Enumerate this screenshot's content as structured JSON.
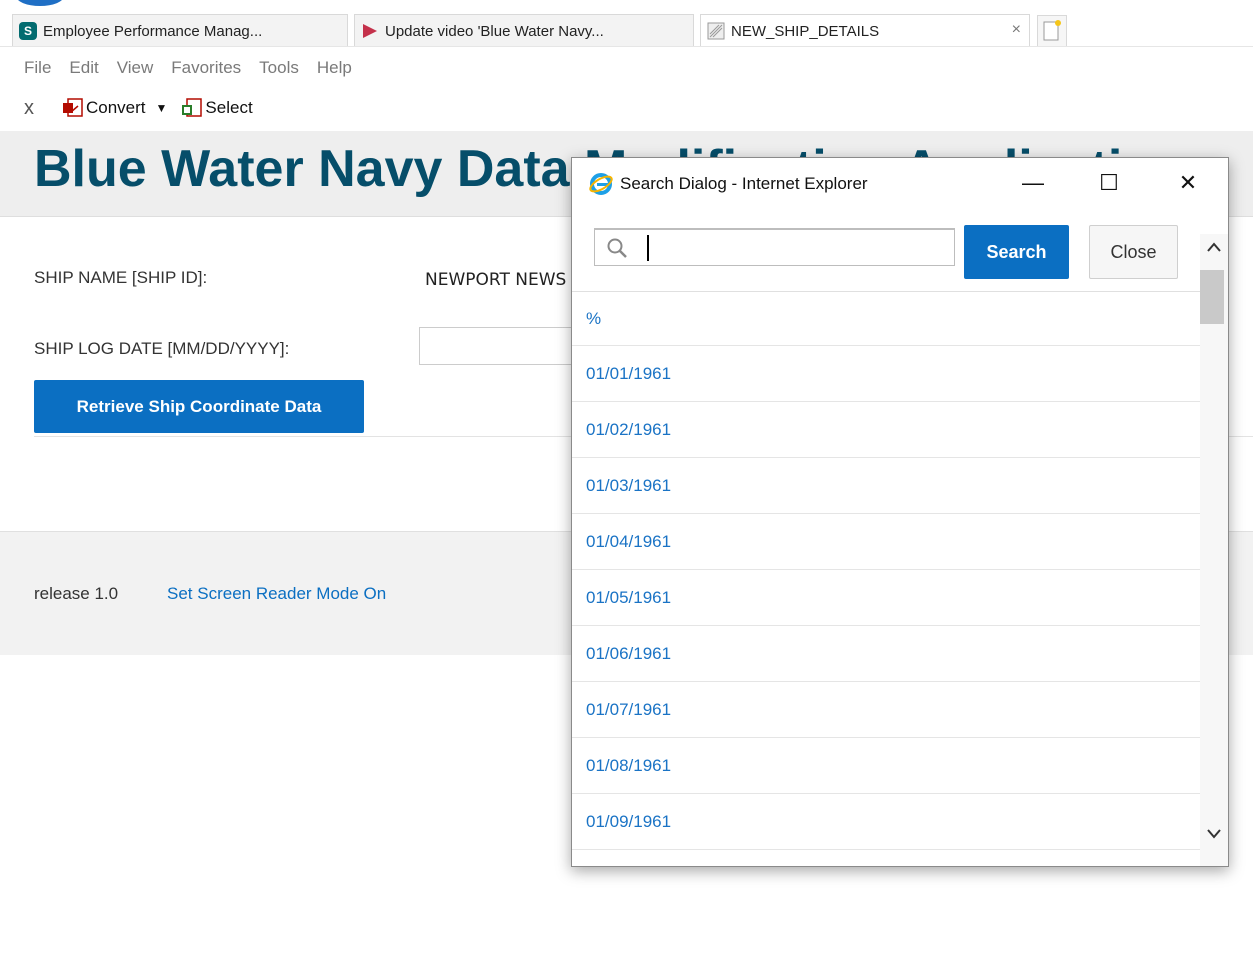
{
  "browser": {
    "tabs": [
      {
        "label": "Employee Performance Manag...",
        "icon": "sharepoint-icon"
      },
      {
        "label": "Update video 'Blue Water Navy...",
        "icon": "stream-video-icon"
      },
      {
        "label": "NEW_SHIP_DETAILS",
        "icon": "page-icon"
      }
    ],
    "close_tab": "×",
    "menu": [
      "File",
      "Edit",
      "View",
      "Favorites",
      "Tools",
      "Help"
    ],
    "toolbar": {
      "close": "x",
      "convert_label": "Convert",
      "caret": "▼",
      "select_label": "Select"
    }
  },
  "page": {
    "title": "Blue Water Navy Data Modification Application",
    "fields": {
      "ship_name_label": "SHIP NAME [SHIP ID]:",
      "ship_name_value": "NEWPORT NEWS",
      "ship_log_date_label": "SHIP LOG DATE [MM/DD/YYYY]:",
      "ship_log_date_value": ""
    },
    "retrieve_button": "Retrieve Ship Coordinate Data",
    "footer": {
      "release": "release 1.0",
      "screen_reader_link": "Set Screen Reader Mode On"
    }
  },
  "dialog": {
    "title": "Search Dialog - Internet Explorer",
    "controls": {
      "minimize": "—",
      "maximize": "☐",
      "close": "✕"
    },
    "search_value": "",
    "search_button": "Search",
    "close_button": "Close",
    "results": [
      "%",
      "01/01/1961",
      "01/02/1961",
      "01/03/1961",
      "01/04/1961",
      "01/05/1961",
      "01/06/1961",
      "01/07/1961",
      "01/08/1961",
      "01/09/1961"
    ],
    "scroll_up": "^",
    "scroll_down": "v"
  },
  "colors": {
    "brand_title": "#064e6a",
    "primary_button": "#0b6fc2",
    "link": "#1a73c5"
  }
}
